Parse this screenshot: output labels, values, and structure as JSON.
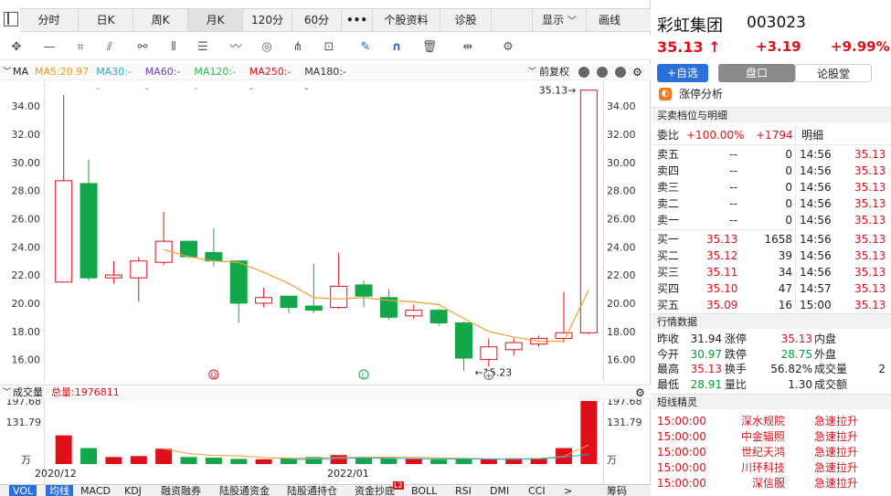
{
  "tabs": [
    "分时",
    "日K",
    "周K",
    "月K",
    "120分",
    "60分",
    "•••",
    "个股资料",
    "诊股"
  ],
  "tab_active": "月K",
  "tab_right": [
    "显示",
    "画线"
  ],
  "ma": {
    "label": "MA",
    "items": [
      {
        "text": "MA5:20.97",
        "color": "#e89a1a"
      },
      {
        "text": "MA30:--",
        "color": "#2aa6d6"
      },
      {
        "text": "MA60:--",
        "color": "#6a3fc4"
      },
      {
        "text": "MA120:--",
        "color": "#2dbb4e"
      },
      {
        "text": "MA250:--",
        "color": "#e0101b"
      },
      {
        "text": "MA180:--",
        "color": "#333333"
      }
    ],
    "fuquan": "前复权"
  },
  "colors": {
    "up": "#e0101b",
    "down": "#12a84a",
    "ma5": "#f0a030"
  },
  "chart_data": {
    "type": "candlestick",
    "y_ticks": [
      "34.00",
      "32.00",
      "30.00",
      "28.00",
      "26.00",
      "24.00",
      "22.00",
      "20.00",
      "18.00",
      "16.00"
    ],
    "ylim": [
      15.0,
      35.5
    ],
    "candles": [
      {
        "o": 21.5,
        "c": 28.7,
        "h": 34.8,
        "l": 21.5
      },
      {
        "o": 28.5,
        "c": 21.8,
        "h": 30.2,
        "l": 21.6
      },
      {
        "o": 21.8,
        "c": 22.0,
        "h": 23.0,
        "l": 21.4
      },
      {
        "o": 21.8,
        "c": 23.0,
        "h": 23.3,
        "l": 20.1
      },
      {
        "o": 22.9,
        "c": 24.4,
        "h": 26.5,
        "l": 22.7
      },
      {
        "o": 24.4,
        "c": 23.3,
        "h": 24.4,
        "l": 23.2
      },
      {
        "o": 23.6,
        "c": 23.0,
        "h": 25.3,
        "l": 22.6
      },
      {
        "o": 23.0,
        "c": 20.0,
        "h": 23.0,
        "l": 18.6
      },
      {
        "o": 20.0,
        "c": 20.4,
        "h": 21.1,
        "l": 19.7
      },
      {
        "o": 20.5,
        "c": 19.7,
        "h": 20.5,
        "l": 19.3
      },
      {
        "o": 19.8,
        "c": 19.5,
        "h": 22.8,
        "l": 19.3
      },
      {
        "o": 19.7,
        "c": 21.2,
        "h": 23.6,
        "l": 19.6
      },
      {
        "o": 21.3,
        "c": 20.5,
        "h": 21.6,
        "l": 19.7
      },
      {
        "o": 20.4,
        "c": 19.0,
        "h": 21.0,
        "l": 18.8
      },
      {
        "o": 19.1,
        "c": 19.5,
        "h": 19.9,
        "l": 18.9
      },
      {
        "o": 19.5,
        "c": 18.6,
        "h": 19.6,
        "l": 18.4
      },
      {
        "o": 18.6,
        "c": 16.1,
        "h": 18.7,
        "l": 15.2
      },
      {
        "o": 16.0,
        "c": 16.9,
        "h": 17.5,
        "l": 15.5
      },
      {
        "o": 16.7,
        "c": 17.2,
        "h": 17.5,
        "l": 16.3
      },
      {
        "o": 17.1,
        "c": 17.5,
        "h": 17.7,
        "l": 16.9
      },
      {
        "o": 17.5,
        "c": 17.9,
        "h": 20.8,
        "l": 17.2
      },
      {
        "o": 17.9,
        "c": 35.13,
        "h": 35.13,
        "l": 17.8
      }
    ],
    "ma5": [
      null,
      null,
      null,
      null,
      23.8,
      23.3,
      23.0,
      22.9,
      22.2,
      21.4,
      20.4,
      20.3,
      20.4,
      20.2,
      20.1,
      19.9,
      18.9,
      18.0,
      17.6,
      17.3,
      17.3,
      20.97
    ],
    "high_label": "35.13",
    "low_label": "15.23",
    "markers": [
      "Q",
      "L"
    ],
    "volume": {
      "y_ticks": [
        "197.68",
        "131.79",
        "万"
      ],
      "values": [
        90,
        50,
        22,
        25,
        48,
        22,
        20,
        16,
        15,
        18,
        22,
        28,
        22,
        18,
        16,
        14,
        18,
        16,
        18,
        18,
        50,
        197.68
      ],
      "ymax": 197.68
    },
    "x_labels": [
      "2020/12",
      "2022/01"
    ]
  },
  "volhead": {
    "label": "成交量",
    "total": "总量:1976811"
  },
  "indicators": [
    "VOL",
    "均线",
    "MACD",
    "KDJ",
    "融资融券",
    "陆股通资金",
    "陆股通持仓",
    "资金抄底",
    "BOLL",
    "RSI",
    "DMI",
    "CCI",
    ">",
    "筹码"
  ],
  "indicator_badge": "L2",
  "stock": {
    "name": "彩虹集团",
    "code": "003023",
    "price": "35.13",
    "arrow": "↑",
    "change": "+3.19",
    "pct": "+9.99%"
  },
  "buttons": {
    "add": "+自选",
    "board": "盘口",
    "forum": "论股堂"
  },
  "limit_up": "涨停分析",
  "order_title": "买卖档位与明细",
  "weibi": {
    "label": "委比",
    "pct": "+100.00%",
    "diff": "+1794",
    "detail": "明细"
  },
  "sells": [
    {
      "name": "卖五",
      "price": "--",
      "vol": "0"
    },
    {
      "name": "卖四",
      "price": "--",
      "vol": "0"
    },
    {
      "name": "卖三",
      "price": "--",
      "vol": "0"
    },
    {
      "name": "卖二",
      "price": "--",
      "vol": "0"
    },
    {
      "name": "卖一",
      "price": "--",
      "vol": "0"
    }
  ],
  "buys": [
    {
      "name": "买一",
      "price": "35.13",
      "vol": "1658"
    },
    {
      "name": "买二",
      "price": "35.12",
      "vol": "39"
    },
    {
      "name": "买三",
      "price": "35.11",
      "vol": "34"
    },
    {
      "name": "买四",
      "price": "35.10",
      "vol": "47"
    },
    {
      "name": "买五",
      "price": "35.09",
      "vol": "16"
    }
  ],
  "details": [
    {
      "time": "14:56",
      "price": "35.13"
    },
    {
      "time": "14:56",
      "price": "35.13"
    },
    {
      "time": "14:56",
      "price": "35.13"
    },
    {
      "time": "14:56",
      "price": "35.13"
    },
    {
      "time": "14:56",
      "price": "35.13"
    },
    {
      "time": "14:56",
      "price": "35.13"
    },
    {
      "time": "14:56",
      "price": "35.13"
    },
    {
      "time": "14:56",
      "price": "35.13"
    },
    {
      "time": "14:57",
      "price": "35.13"
    },
    {
      "time": "15:00",
      "price": "35.13"
    }
  ],
  "market_title": "行情数据",
  "market": [
    [
      {
        "l": "昨收",
        "v": "31.94",
        "c": "dark"
      },
      {
        "l": "涨停",
        "v": "35.13",
        "c": "red"
      },
      {
        "l": "内盘",
        "v": "",
        "c": "dark"
      }
    ],
    [
      {
        "l": "今开",
        "v": "30.97",
        "c": "green"
      },
      {
        "l": "跌停",
        "v": "28.75",
        "c": "green"
      },
      {
        "l": "外盘",
        "v": "",
        "c": "dark"
      }
    ],
    [
      {
        "l": "最高",
        "v": "35.13",
        "c": "red"
      },
      {
        "l": "换手",
        "v": "56.82%",
        "c": "dark"
      },
      {
        "l": "成交量",
        "v": "2",
        "c": "dark"
      }
    ],
    [
      {
        "l": "最低",
        "v": "28.91",
        "c": "green"
      },
      {
        "l": "量比",
        "v": "1.30",
        "c": "dark"
      },
      {
        "l": "成交额",
        "v": "",
        "c": "dark"
      }
    ]
  ],
  "short_title": "短线精灵",
  "short": [
    {
      "time": "15:00:00",
      "name": "深水规院",
      "event": "急速拉升"
    },
    {
      "time": "15:00:00",
      "name": "中金辐照",
      "event": "急速拉升"
    },
    {
      "time": "15:00:00",
      "name": "世纪天鸿",
      "event": "急速拉升"
    },
    {
      "time": "15:00:00",
      "name": "川环科技",
      "event": "急速拉升"
    },
    {
      "time": "15:00:00",
      "name": "深信服",
      "event": "急速拉升"
    }
  ]
}
